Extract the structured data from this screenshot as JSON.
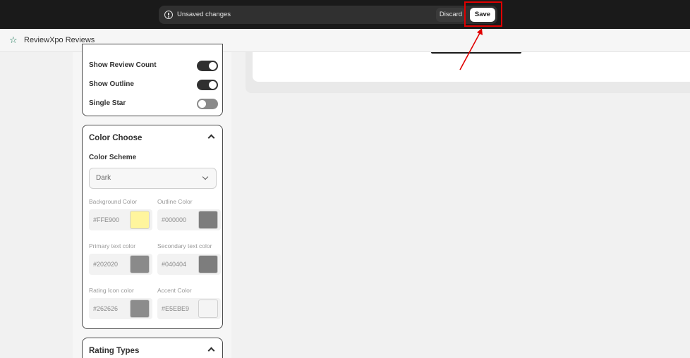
{
  "savebar": {
    "message": "Unsaved changes",
    "discard_label": "Discard",
    "save_label": "Save"
  },
  "app": {
    "title": "ReviewXpo Reviews",
    "icon": "star-icon"
  },
  "toggles": [
    {
      "label": "Show Review Count",
      "state": "on"
    },
    {
      "label": "Show Outline",
      "state": "on"
    },
    {
      "label": "Single Star",
      "state": "off"
    }
  ],
  "color_choose": {
    "title": "Color Choose",
    "scheme_label": "Color Scheme",
    "scheme_value": "Dark",
    "fields": [
      {
        "label": "Background Color",
        "value": "#FFE900",
        "swatch": "#fff59d"
      },
      {
        "label": "Outline Color",
        "value": "#000000",
        "swatch": "#7d7d7d"
      },
      {
        "label": "Primary text color",
        "value": "#202020",
        "swatch": "#8a8a8a"
      },
      {
        "label": "Secondary text color",
        "value": "#040404",
        "swatch": "#7d7d7d"
      },
      {
        "label": "Rating Icon color",
        "value": "#262626",
        "swatch": "#8c8c8c"
      },
      {
        "label": "Accent Color",
        "value": "#E5EBE9",
        "swatch": "#f4f4f4"
      }
    ]
  },
  "rating_types": {
    "title": "Rating Types"
  }
}
